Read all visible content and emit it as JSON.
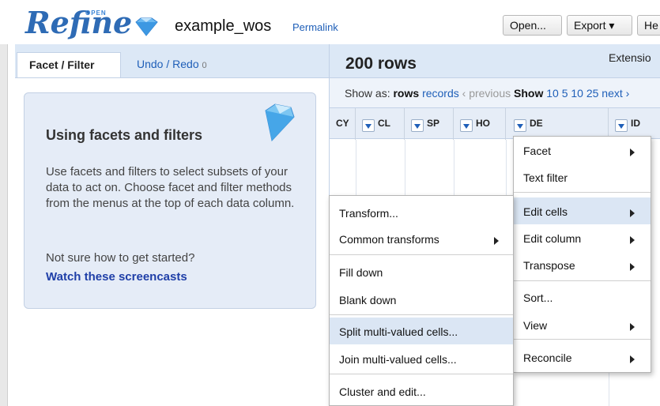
{
  "header": {
    "logo_text": "Refine",
    "logo_badge": "OPEN",
    "project_name": "example_wos",
    "permalink": "Permalink",
    "buttons": {
      "open": "Open...",
      "export": "Export ▾",
      "help": "He"
    }
  },
  "left_panel": {
    "tabs": {
      "facet_filter": "Facet / Filter",
      "undo_redo": "Undo / Redo",
      "undo_count": "0"
    },
    "help": {
      "title": "Using facets and filters",
      "body": "Use facets and filters to select subsets of your data to act on. Choose facet and filter methods from the menus at the top of each data column.",
      "question": "Not sure how to get started?",
      "link": "Watch these screencasts"
    }
  },
  "right_panel": {
    "row_count": "200 rows",
    "extensions": "Extensio",
    "show_as_label": "Show as:",
    "show_as_rows": "rows",
    "show_as_records": "records",
    "prev_label": "‹ previous",
    "show_label": "Show",
    "page_sizes": "10  5  10  25",
    "next_label": "next ›",
    "columns": [
      "CY",
      "CL",
      "SP",
      "HO",
      "DE",
      "ID"
    ]
  },
  "column_menu": {
    "items": [
      {
        "label": "Facet",
        "submenu": true
      },
      {
        "label": "Text filter",
        "submenu": false
      },
      {
        "label": "Edit cells",
        "submenu": true,
        "highlighted": true
      },
      {
        "label": "Edit column",
        "submenu": true
      },
      {
        "label": "Transpose",
        "submenu": true
      },
      {
        "label": "Sort...",
        "submenu": false
      },
      {
        "label": "View",
        "submenu": true
      },
      {
        "label": "Reconcile",
        "submenu": true
      }
    ]
  },
  "edit_cells_menu": {
    "items": [
      {
        "label": "Transform...",
        "submenu": false
      },
      {
        "label": "Common transforms",
        "submenu": true
      },
      {
        "label": "Fill down",
        "submenu": false
      },
      {
        "label": "Blank down",
        "submenu": false
      },
      {
        "label": "Split multi-valued cells...",
        "submenu": false,
        "highlighted": true
      },
      {
        "label": "Join multi-valued cells...",
        "submenu": false
      },
      {
        "label": "Cluster and edit...",
        "submenu": false
      }
    ]
  },
  "colors": {
    "accent": "#1f5fb8",
    "panel": "#dce8f6",
    "highlight": "#dbe6f4"
  },
  "icons": {
    "logo_gem": "diamond-icon",
    "help_gem": "diamond-icon",
    "column_dropdown": "triangle-down-icon",
    "submenu": "triangle-right-icon"
  }
}
